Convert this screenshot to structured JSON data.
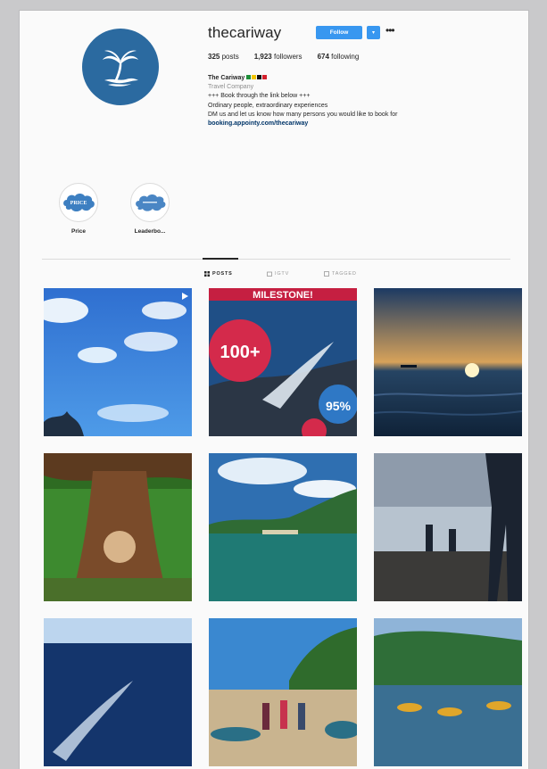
{
  "profile": {
    "username": "thecariway",
    "follow_label": "Follow",
    "dropdown_glyph": "▾",
    "more_glyph": "•••",
    "stats": {
      "posts": "325",
      "posts_label": "posts",
      "followers": "1,923",
      "followers_label": "followers",
      "following": "674",
      "following_label": "following"
    },
    "bio": {
      "name": "The Cariway",
      "flag_colors": [
        "#1f8f3a",
        "#f2c500",
        "#111111",
        "#d41f2c"
      ],
      "category": "Travel Company",
      "line1": "+++ Book through the link below +++",
      "line2": "Ordinary people, extraordinary experiences",
      "line3": "DM us and let us know how many persons you would like to book for",
      "link": "booking.appointy.com/thecariway"
    },
    "avatar_icon": "palm-tree-icon",
    "brand_color": "#2b6aa0"
  },
  "highlights": [
    {
      "label": "Price",
      "badge": "PRICE"
    },
    {
      "label": "Leaderbo..."
    }
  ],
  "tabs": [
    {
      "label": "POSTS",
      "icon": "grid-icon",
      "active": true
    },
    {
      "label": "IGTV",
      "icon": "tv-icon",
      "active": false
    },
    {
      "label": "TAGGED",
      "icon": "tag-icon",
      "active": false
    }
  ],
  "posts": {
    "milestone": {
      "headline": "MILESTONE!",
      "big_number": "100+",
      "percent": "95%"
    }
  }
}
